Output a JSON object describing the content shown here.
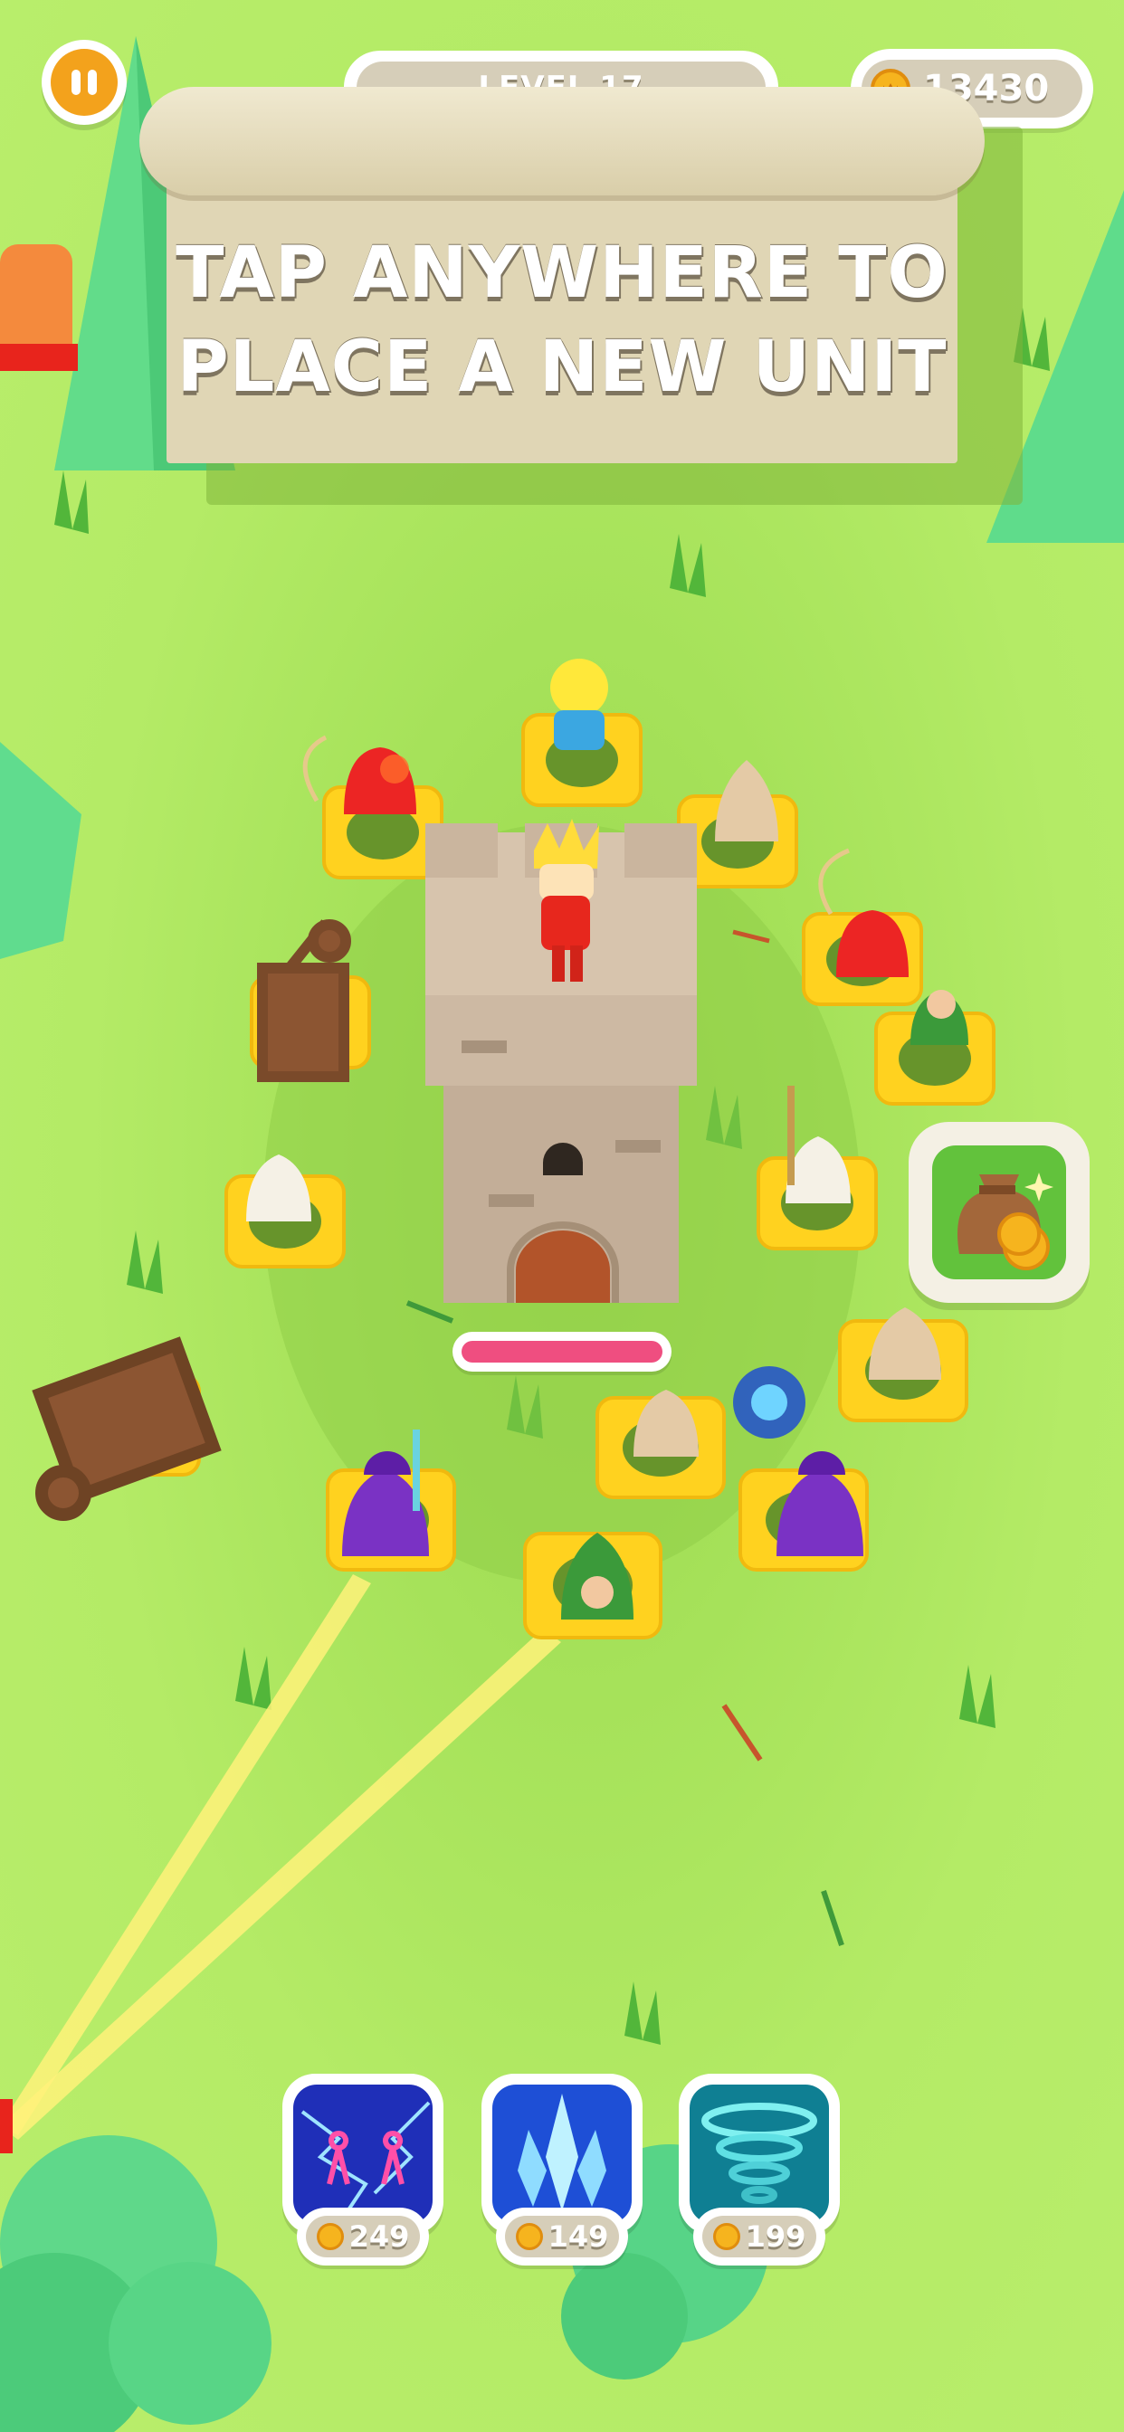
{
  "hud": {
    "level_label": "LEVEL 17",
    "coins": "13430",
    "pause_icon": "pause-icon",
    "coin_icon": "coin-icon"
  },
  "banner": {
    "line1": "TAP ANYWHERE TO",
    "line2": "PLACE A NEW UNIT"
  },
  "tower": {
    "health_fraction": 1.0
  },
  "shop": {
    "icon": "money-bag-icon"
  },
  "abilities": [
    {
      "icon": "lightning-strike-icon",
      "price": "249"
    },
    {
      "icon": "ice-crystal-icon",
      "price": "149"
    },
    {
      "icon": "tornado-icon",
      "price": "199"
    }
  ],
  "colors": {
    "grass": "#b5ec66",
    "accent_orange": "#f3a21c",
    "health_pink": "#ef4e80",
    "slot_yellow": "#ffd21f",
    "parchment": "#e0d6b5"
  }
}
